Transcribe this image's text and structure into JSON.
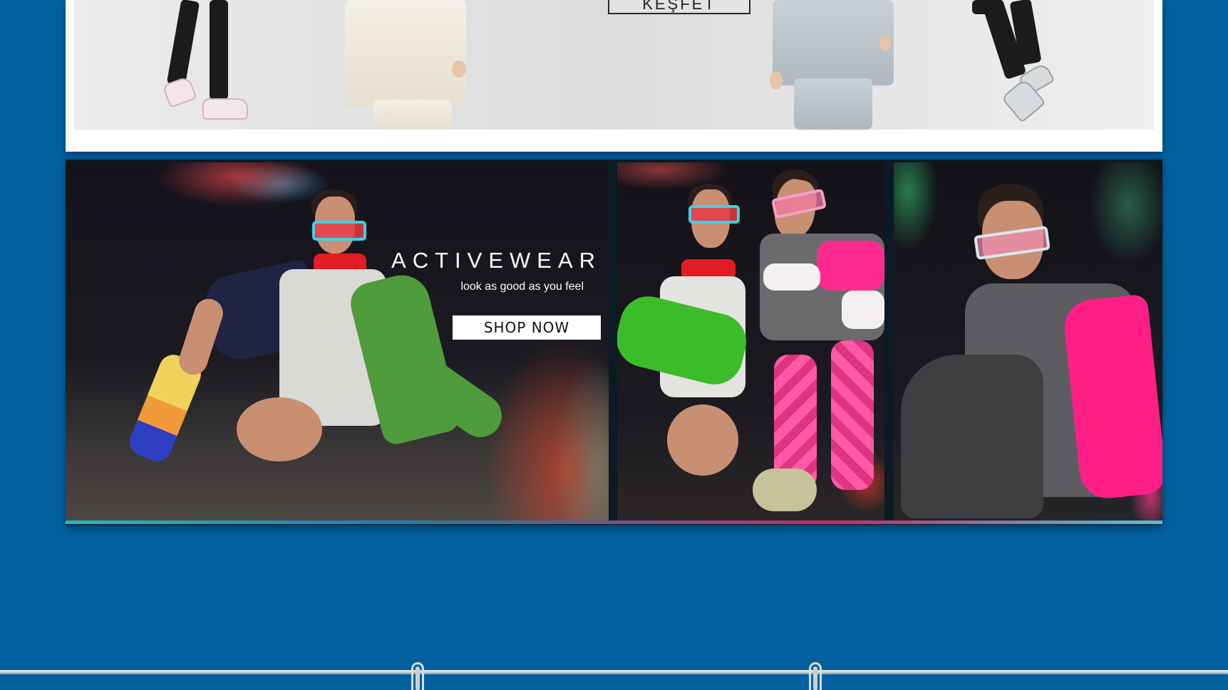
{
  "top_banner": {
    "explore_label": "KEŞFET"
  },
  "activewear_banner": {
    "title": "ACTIVEWEAR",
    "tagline": "look as good as you feel",
    "cta_label": "SHOP NOW"
  },
  "colors": {
    "page_background": "#03609f",
    "card_background": "#ffffff",
    "banner_dark": "#14121a",
    "cta_background": "#ffffff"
  }
}
